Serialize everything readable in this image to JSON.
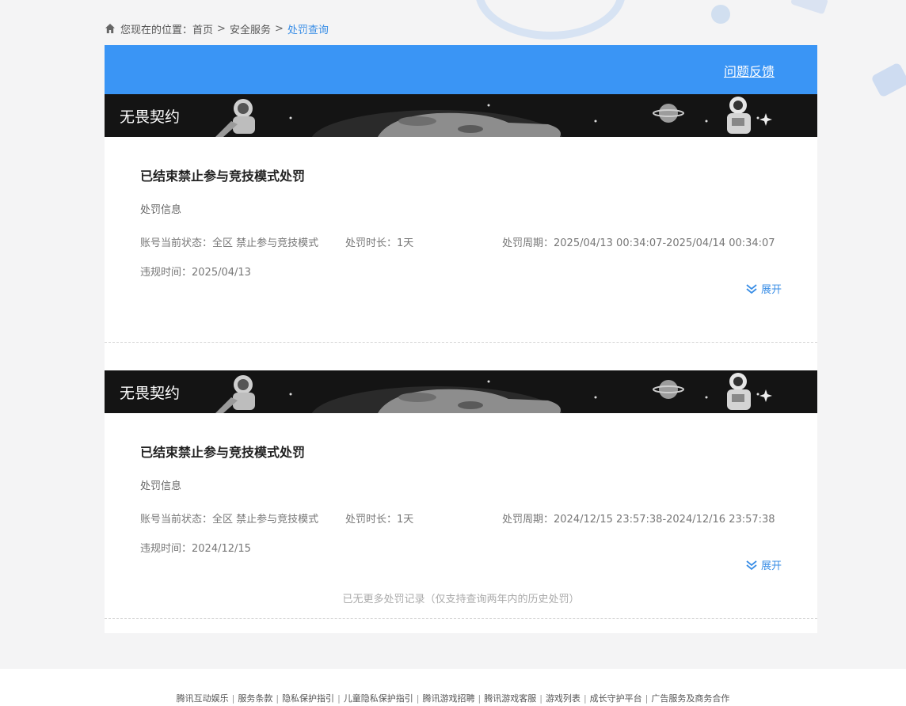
{
  "breadcrumb": {
    "prefix": "您现在的位置：",
    "items": [
      "首页",
      "安全服务",
      "处罚查询"
    ],
    "separator": ">"
  },
  "header": {
    "feedback_label": "问题反馈",
    "accent_color": "#3a95f5"
  },
  "records": [
    {
      "banner_title": "无畏契约",
      "title": "已结束禁止参与竞技模式处罚",
      "section_label": "处罚信息",
      "status": "账号当前状态：全区 禁止参与竞技模式",
      "duration": "处罚时长：1天",
      "period": "处罚周期：2025/04/13 00:34:07-2025/04/14 00:34:07",
      "violation_time": "违规时间：2025/04/13",
      "expand_label": "展开"
    },
    {
      "banner_title": "无畏契约",
      "title": "已结束禁止参与竞技模式处罚",
      "section_label": "处罚信息",
      "status": "账号当前状态：全区 禁止参与竞技模式",
      "duration": "处罚时长：1天",
      "period": "处罚周期：2024/12/15 23:57:38-2024/12/16 23:57:38",
      "violation_time": "违规时间：2024/12/15",
      "expand_label": "展开"
    }
  ],
  "no_more_text": "已无更多处罚记录（仅支持查询两年内的历史处罚）",
  "footer": {
    "links": [
      "腾讯互动娱乐",
      "服务条款",
      "隐私保护指引",
      "儿童隐私保护指引",
      "腾讯游戏招聘",
      "腾讯游戏客服",
      "游戏列表",
      "成长守护平台",
      "广告服务及商务合作"
    ],
    "separator": "|"
  },
  "icons": {
    "home": "home-icon",
    "expand": "double-chevron-down-icon"
  }
}
